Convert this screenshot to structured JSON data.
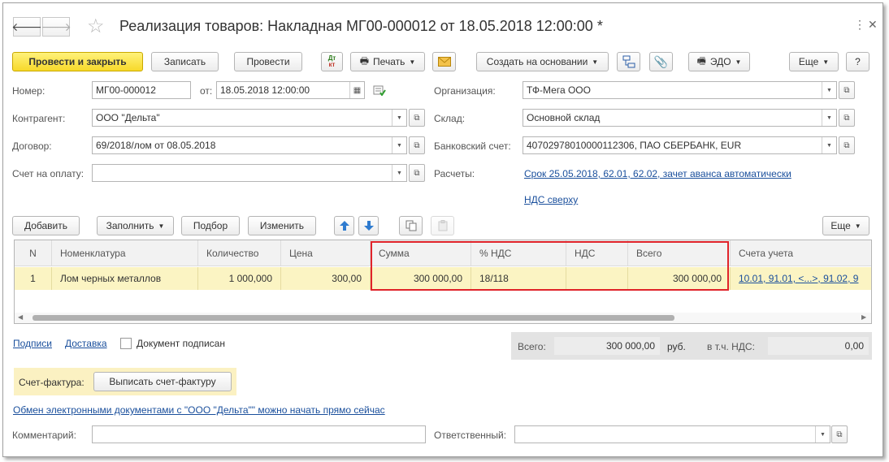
{
  "window": {
    "title": "Реализация товаров: Накладная МГ00-000012 от 18.05.2018 12:00:00 *",
    "controls": {
      "more": "⋮",
      "close": "✕"
    }
  },
  "nav": {
    "back": "🡐",
    "forward": "🡒",
    "favorite": "☆"
  },
  "toolbar": {
    "post_close": "Провести и закрыть",
    "save": "Записать",
    "post": "Провести",
    "dtkt_top": "Дт",
    "dtkt_bottom": "кт",
    "print": "Печать",
    "create_based": "Создать на основании",
    "edo": "ЭДО",
    "more": "Еще",
    "help": "?"
  },
  "form": {
    "number_label": "Номер:",
    "number_value": "МГ00-000012",
    "date_label": "от:",
    "date_value": "18.05.2018 12:00:00",
    "org_label": "Организация:",
    "org_value": "ТФ-Мега ООО",
    "counterparty_label": "Контрагент:",
    "counterparty_value": "ООО \"Дельта\"",
    "warehouse_label": "Склад:",
    "warehouse_value": "Основной склад",
    "contract_label": "Договор:",
    "contract_value": "69/2018/лом от 08.05.2018",
    "bank_label": "Банковский счет:",
    "bank_value": "40702978010000112306, ПАО СБЕРБАНК, EUR",
    "invoice_label": "Счет на оплату:",
    "invoice_value": "",
    "settlements_label": "Расчеты:",
    "settlements_link": "Срок 25.05.2018, 62.01, 62.02, зачет аванса автоматически",
    "vat_link": "НДС сверху"
  },
  "table_toolbar": {
    "add": "Добавить",
    "fill": "Заполнить",
    "pick": "Подбор",
    "change": "Изменить",
    "more": "Еще"
  },
  "table": {
    "headers": [
      "N",
      "Номенклатура",
      "Количество",
      "Цена",
      "Сумма",
      "% НДС",
      "НДС",
      "Всего",
      "Счета учета"
    ],
    "rows": [
      [
        "1",
        "Лом черных металлов",
        "1 000,000",
        "300,00",
        "300 000,00",
        "18/118",
        "",
        "300 000,00",
        "10.01, 91.01, <...>, 91.02, 9"
      ]
    ]
  },
  "footer": {
    "signatures_link": "Подписи",
    "delivery_link": "Доставка",
    "signed_label": "Документ подписан",
    "total_label": "Всего:",
    "total_value": "300 000,00",
    "currency": "руб.",
    "vat_incl_label": "в т.ч. НДС:",
    "vat_value": "0,00",
    "sf_label": "Счет-фактура:",
    "sf_button": "Выписать счет-фактуру",
    "edo_link": "Обмен электронными документами с \"ООО \"Дельта\"\" можно начать прямо сейчас",
    "comment_label": "Комментарий:",
    "comment_value": "",
    "responsible_label": "Ответственный:",
    "responsible_value": ""
  },
  "colors": {
    "primary_button": "#f7d92a",
    "row_highlight": "#fbf4c3",
    "link": "#1a4f9c",
    "annotation_box": "#e0232a"
  }
}
